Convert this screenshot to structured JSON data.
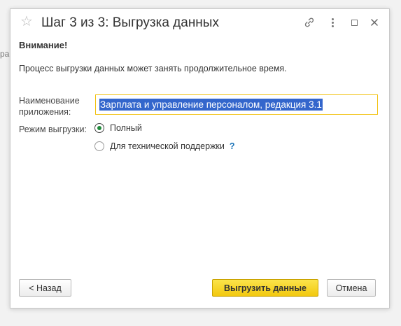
{
  "background": {
    "fragment_text": "рам"
  },
  "window": {
    "title": "Шаг 3 из 3: Выгрузка данных",
    "icons": {
      "favorite": "star-icon",
      "link": "link-icon",
      "more": "more-icon",
      "maximize": "maximize-icon",
      "close": "close-icon"
    }
  },
  "warning": {
    "title": "Внимание!",
    "text": "Процесс выгрузки данных может занять продолжительное время."
  },
  "form": {
    "app_name_label": "Наименование приложения:",
    "app_name_value": "Зарплата и управление персоналом, редакция 3.1",
    "mode_label": "Режим выгрузки:",
    "mode_options": [
      {
        "label": "Полный",
        "selected": true
      },
      {
        "label": "Для технической поддержки",
        "selected": false,
        "help": "?"
      }
    ]
  },
  "buttons": {
    "back": "< Назад",
    "export": "Выгрузить данные",
    "cancel": "Отмена"
  },
  "colors": {
    "accent_yellow": "#f2c80e",
    "selection_blue": "#3366cc",
    "radio_green": "#1f8a3a",
    "help_blue": "#1a73b8"
  }
}
